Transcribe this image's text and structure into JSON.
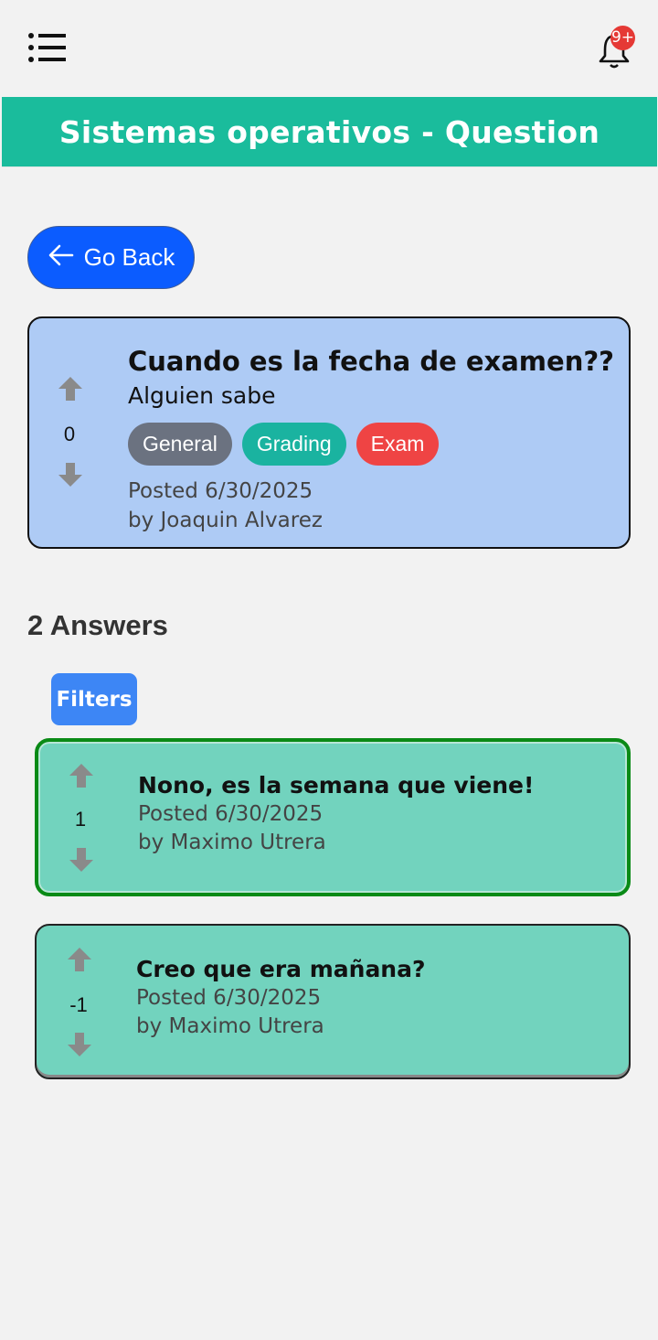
{
  "header": {
    "notification_badge": "9+",
    "title": "Sistemas operativos  - Question"
  },
  "nav": {
    "go_back_label": "Go Back"
  },
  "question": {
    "votes": "0",
    "title": "Cuando es la fecha de examen??",
    "body": "Alguien sabe",
    "tags": [
      {
        "label": "General",
        "color": "#6b7280"
      },
      {
        "label": "Grading",
        "color": "#1ab3a0"
      },
      {
        "label": "Exam",
        "color": "#ef4444"
      }
    ],
    "posted": "Posted 6/30/2025",
    "author": "by Joaquin Alvarez"
  },
  "answers_section": {
    "heading": "2 Answers",
    "filters_label": "Filters",
    "answers": [
      {
        "votes": "1",
        "text": "Nono, es la semana que viene!",
        "posted": "Posted 6/30/2025",
        "author": "by Maximo Utrera",
        "accepted": true
      },
      {
        "votes": "-1",
        "text": "Creo que era mañana?",
        "posted": "Posted 6/30/2025",
        "author": "by Maximo Utrera",
        "accepted": false
      }
    ]
  },
  "colors": {
    "header_bg": "#1abc9c",
    "go_back_bg": "#0b5cff",
    "question_card_bg": "#aecbf5",
    "answer_card_bg": "#72d3be",
    "accepted_border": "#0a8a16",
    "filters_bg": "#3d86f5"
  },
  "icons": {
    "menu": "menu-list-icon",
    "bell": "bell-icon",
    "back": "arrow-left-icon",
    "upvote": "arrow-up-icon",
    "downvote": "arrow-down-icon"
  }
}
